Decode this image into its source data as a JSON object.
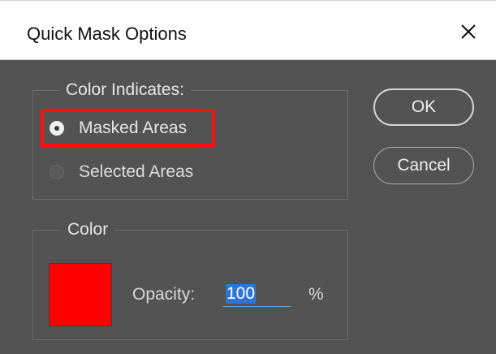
{
  "window": {
    "title": "Quick Mask Options",
    "close_icon": "close-icon"
  },
  "color_indicates": {
    "legend": "Color Indicates:",
    "options": [
      {
        "label": "Masked Areas",
        "selected": true
      },
      {
        "label": "Selected Areas",
        "selected": false
      }
    ],
    "highlight_color": "#ff1010"
  },
  "color_group": {
    "legend": "Color",
    "swatch_color": "#ff0000",
    "opacity_label": "Opacity:",
    "opacity_value": "100",
    "opacity_unit": "%"
  },
  "buttons": {
    "ok_label": "OK",
    "cancel_label": "Cancel"
  }
}
